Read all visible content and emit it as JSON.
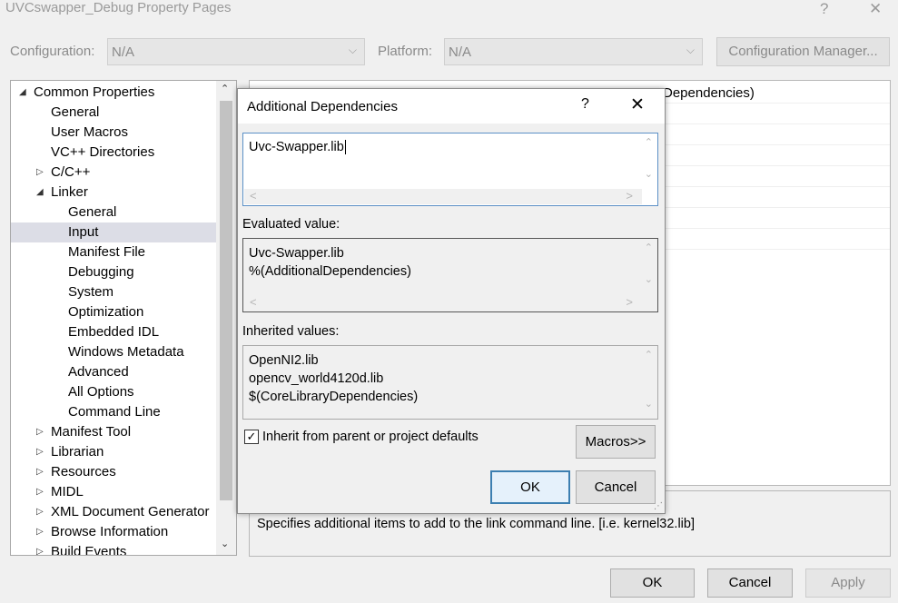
{
  "window": {
    "title": "UVCswapper_Debug Property Pages",
    "help_glyph": "?",
    "close_glyph": "✕"
  },
  "config": {
    "configuration_label": "Configuration:",
    "configuration_value": "N/A",
    "platform_label": "Platform:",
    "platform_value": "N/A",
    "manager_button": "Configuration Manager...",
    "chevron": "⌵"
  },
  "tree": {
    "items": [
      {
        "label": "Common Properties",
        "twisty": "◢"
      },
      {
        "label": "General",
        "twisty": ""
      },
      {
        "label": "User Macros",
        "twisty": ""
      },
      {
        "label": "VC++ Directories",
        "twisty": ""
      },
      {
        "label": "C/C++",
        "twisty": "▷"
      },
      {
        "label": "Linker",
        "twisty": "◢"
      },
      {
        "label": "General",
        "twisty": ""
      },
      {
        "label": "Input",
        "twisty": ""
      },
      {
        "label": "Manifest File",
        "twisty": ""
      },
      {
        "label": "Debugging",
        "twisty": ""
      },
      {
        "label": "System",
        "twisty": ""
      },
      {
        "label": "Optimization",
        "twisty": ""
      },
      {
        "label": "Embedded IDL",
        "twisty": ""
      },
      {
        "label": "Windows Metadata",
        "twisty": ""
      },
      {
        "label": "Advanced",
        "twisty": ""
      },
      {
        "label": "All Options",
        "twisty": ""
      },
      {
        "label": "Command Line",
        "twisty": ""
      },
      {
        "label": "Manifest Tool",
        "twisty": "▷"
      },
      {
        "label": "Librarian",
        "twisty": "▷"
      },
      {
        "label": "Resources",
        "twisty": "▷"
      },
      {
        "label": "MIDL",
        "twisty": "▷"
      },
      {
        "label": "XML Document Generator",
        "twisty": "▷"
      },
      {
        "label": "Browse Information",
        "twisty": "▷"
      },
      {
        "label": "Build Events",
        "twisty": "▷"
      }
    ],
    "scroll_up": "⌃",
    "scroll_down": "⌄"
  },
  "grid": {
    "visible_value": "Dependencies)"
  },
  "description": "Specifies additional items to add to the link command line. [i.e. kernel32.lib]",
  "footer": {
    "ok": "OK",
    "cancel": "Cancel",
    "apply": "Apply"
  },
  "dialog": {
    "title": "Additional Dependencies",
    "help_glyph": "?",
    "close_glyph": "✕",
    "edit_value": "Uvc-Swapper.lib",
    "evaluated_label": "Evaluated value:",
    "evaluated_lines": [
      "Uvc-Swapper.lib",
      "%(AdditionalDependencies)"
    ],
    "inherited_label": "Inherited values:",
    "inherited_lines": [
      "OpenNI2.lib",
      "opencv_world4120d.lib",
      "$(CoreLibraryDependencies)"
    ],
    "inherit_checkbox_label": "Inherit from parent or project defaults",
    "inherit_checked": "✓",
    "macros_button": "Macros>>",
    "ok_button": "OK",
    "cancel_button": "Cancel",
    "scroll_left": "<",
    "scroll_right": ">",
    "scroll_up": "⌃",
    "scroll_down": "⌄",
    "grip": "⋰"
  }
}
